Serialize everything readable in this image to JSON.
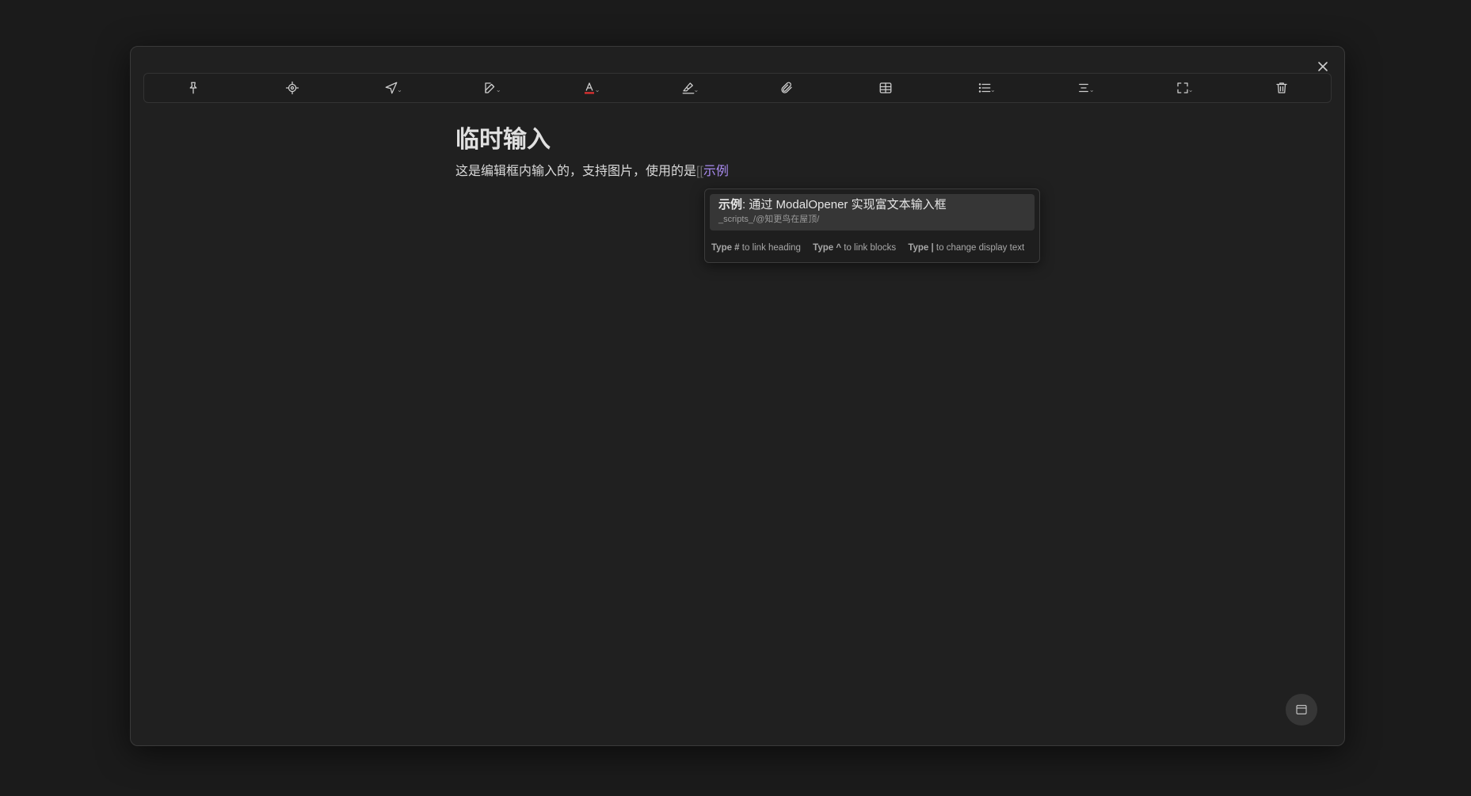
{
  "toolbar": {
    "buttons": [
      {
        "icon": "pin-icon",
        "has_dropdown": false
      },
      {
        "icon": "crosshair-icon",
        "has_dropdown": false
      },
      {
        "icon": "navigation-arrow-icon",
        "has_dropdown": true
      },
      {
        "icon": "edit-icon",
        "has_dropdown": true
      },
      {
        "icon": "font-color-icon",
        "has_dropdown": true,
        "color": "#e03131"
      },
      {
        "icon": "highlighter-icon",
        "has_dropdown": true
      },
      {
        "icon": "paperclip-icon",
        "has_dropdown": false
      },
      {
        "icon": "table-icon",
        "has_dropdown": false
      },
      {
        "icon": "list-icon",
        "has_dropdown": true
      },
      {
        "icon": "align-center-icon",
        "has_dropdown": true
      },
      {
        "icon": "fullscreen-icon",
        "has_dropdown": true
      },
      {
        "icon": "trash-icon",
        "has_dropdown": false
      }
    ],
    "caret": "⌄"
  },
  "editor": {
    "title": "临时输入",
    "paragraph_text": "这是编辑框内输入的，支持图片，使用的是",
    "link_open": "[[",
    "link_query": "示例"
  },
  "suggestion": {
    "item_bold": "示例",
    "item_rest": ": 通过 ModalOpener 实现富文本输入框",
    "item_path": "_scripts_/@知更鸟在屋顶/",
    "footer": [
      {
        "key": "Type #",
        "text": "to link heading"
      },
      {
        "key": "Type ^",
        "text": "to link blocks"
      },
      {
        "key": "Type |",
        "text": "to change display text"
      }
    ]
  },
  "colors": {
    "background": "#1b1b1b",
    "modal": "#202020",
    "link": "#a98bf0",
    "font_color_bar": "#e03131"
  }
}
